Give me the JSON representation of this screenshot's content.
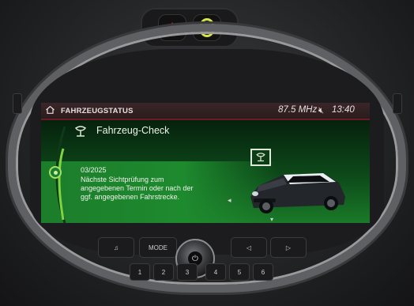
{
  "status_bar": {
    "title": "FAHRZEUGSTATUS",
    "radio": "87.5 MHz",
    "clock": "13:40",
    "icons": [
      "home-icon",
      "mute-icon"
    ]
  },
  "content": {
    "heading": "Fahrzeug-Check",
    "heading_icon": "service-icon",
    "date": "03/2025",
    "message_lines": [
      "Nächste Sichtprüfung zum",
      "angegebenen Termin oder nach der",
      "ggf. angegebenen Fahrstrecke."
    ]
  },
  "controls": {
    "mode_label": "MODE",
    "presets": [
      "1",
      "2",
      "3",
      "4",
      "5",
      "6"
    ]
  },
  "colors": {
    "accent_red": "#6a1c22",
    "screen_green": "#1e8a2e",
    "hazard_red": "#e3262b",
    "lock_yellow": "#d6e34a"
  }
}
